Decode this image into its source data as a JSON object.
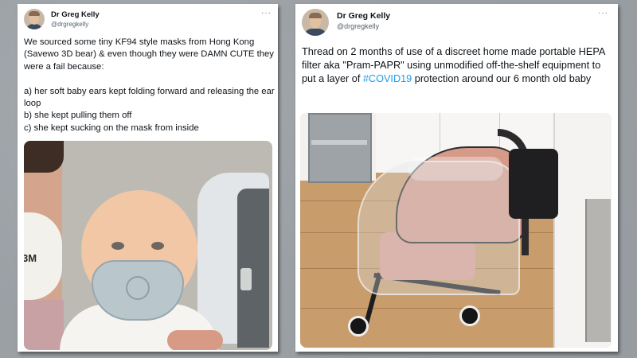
{
  "left_tweet": {
    "author_name": "Dr Greg Kelly",
    "author_handle": "@drgregkelly",
    "more_label": "···",
    "text": "We sourced some tiny KF94 style masks from Hong Kong (Savewo 3D bear) & even though they were DAMN CUTE they were a fail because:\n\na) her soft baby ears kept folding forward and releasing the ear loop\nb) she kept pulling them off\nc) she kept sucking on the mask from inside",
    "photo_mask_text": "3M"
  },
  "right_tweet": {
    "author_name": "Dr Greg Kelly",
    "author_handle": "@drgregkelly",
    "more_label": "···",
    "text_before_hashtag": "Thread on 2 months of use of a discreet home made portable HEPA filter aka \"Pram-PAPR\" using unmodified off-the-shelf equipment to put a layer of ",
    "hashtag": "#COVID19",
    "text_after_hashtag": " protection around our 6 month old baby"
  },
  "colors": {
    "background": "#9ea3a8",
    "card": "#ffffff",
    "hashtag": "#1d9bf0",
    "handle": "#536471"
  },
  "icons": {
    "more": "ellipsis-icon",
    "avatar": "profile-photo"
  }
}
